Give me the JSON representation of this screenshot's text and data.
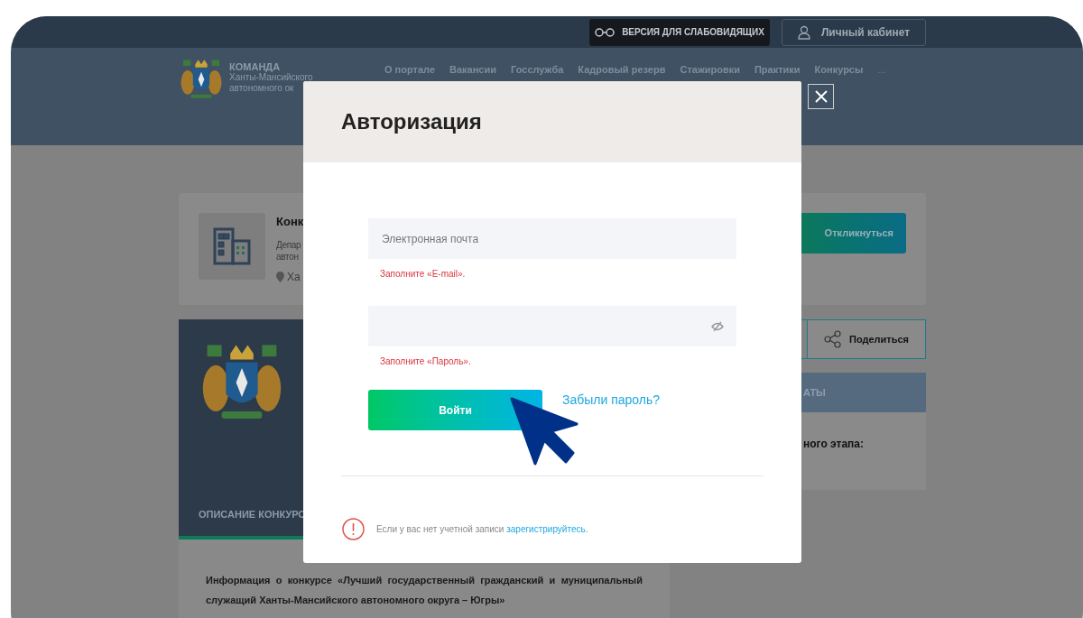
{
  "top_bar": {
    "accessibility_button": "ВЕРСИЯ ДЛЯ СЛАБОВИДЯЩИХ",
    "account_button": "Личный кабинет"
  },
  "header": {
    "logo_title": "КОМАНДА",
    "logo_lines": [
      "Ханты-Мансийского",
      "автономного ок"
    ],
    "nav": [
      "О портале",
      "Вакансии",
      "Госслужба",
      "Кадровый резерв",
      "Стажировки",
      "Практики",
      "Конкурсы"
    ],
    "more": "..."
  },
  "contest_card": {
    "title": "Конк",
    "lines": [
      "Депар",
      "автон"
    ],
    "location": "Ха",
    "respond_button": "Откликнуться"
  },
  "share_button": "Поделиться",
  "left_panel": {
    "tab": "ОПИСАНИЕ КОНКУРС",
    "info_text": "Информация о конкурсе «Лучший государственный гражданский  и муниципальный служащий Ханты-Мансийского автономного округа – Югры»"
  },
  "side_card": {
    "header": "АТЫ",
    "text": "ного этапа:"
  },
  "modal": {
    "title": "Авторизация",
    "fields": [
      {
        "kind": "text",
        "placeholder": "Электронная почта",
        "error": "Заполните «E-mail»."
      },
      {
        "kind": "password",
        "error": "Заполните «Пароль»."
      }
    ],
    "submit_button": "Войти",
    "forgot_link": "Забыли пароль?",
    "notice": {
      "text": "Если у вас нет учетной записи",
      "link": "зарегистрируйтесь",
      "after": "."
    }
  }
}
